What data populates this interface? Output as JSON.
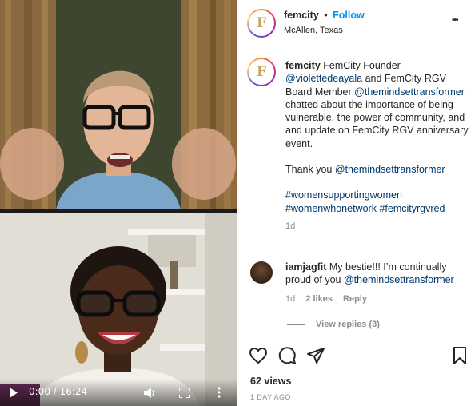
{
  "video": {
    "time_display": "0:00 / 16:24",
    "icons": [
      "play-icon",
      "volume-icon",
      "fullscreen-icon",
      "more-vertical-icon"
    ]
  },
  "header": {
    "username": "femcity",
    "separator": "•",
    "follow_label": "Follow",
    "location": "McAllen, Texas",
    "avatar_letter": "F",
    "more_label": "•••"
  },
  "caption": {
    "username": "femcity",
    "text_1": "FemCity Founder",
    "mention_1": "@violettedeayala",
    "text_2": "and FemCity RGV Board Member",
    "mention_2": "@themindsettransformer",
    "text_3": "chatted about the importance of being vulnerable, the power of community, and and update on FemCity RGV anniversary event.",
    "thanks_text": "Thank you",
    "thanks_mention": "@themindsettransformer",
    "hashtag_1": "#womensupportingwomen",
    "hashtag_2": "#womenwhonetwork",
    "hashtag_3": "#femcityrgvred",
    "age": "1d"
  },
  "comment": {
    "username": "iamjagfit",
    "text": "My bestie!!! I’m continually proud of you",
    "mention": "@themindsettransformer",
    "age": "1d",
    "likes": "2 likes",
    "reply_label": "Reply",
    "view_replies": "View replies (3)"
  },
  "actions": {
    "icons": [
      "heart-icon",
      "comment-icon",
      "share-icon",
      "bookmark-icon"
    ],
    "views": "62 views",
    "date": "1 DAY AGO"
  },
  "colors": {
    "link_blue": "#0095f6",
    "mention_blue": "#00376b",
    "muted": "#8e8e8e",
    "brand_gold": "#c9a25a"
  }
}
